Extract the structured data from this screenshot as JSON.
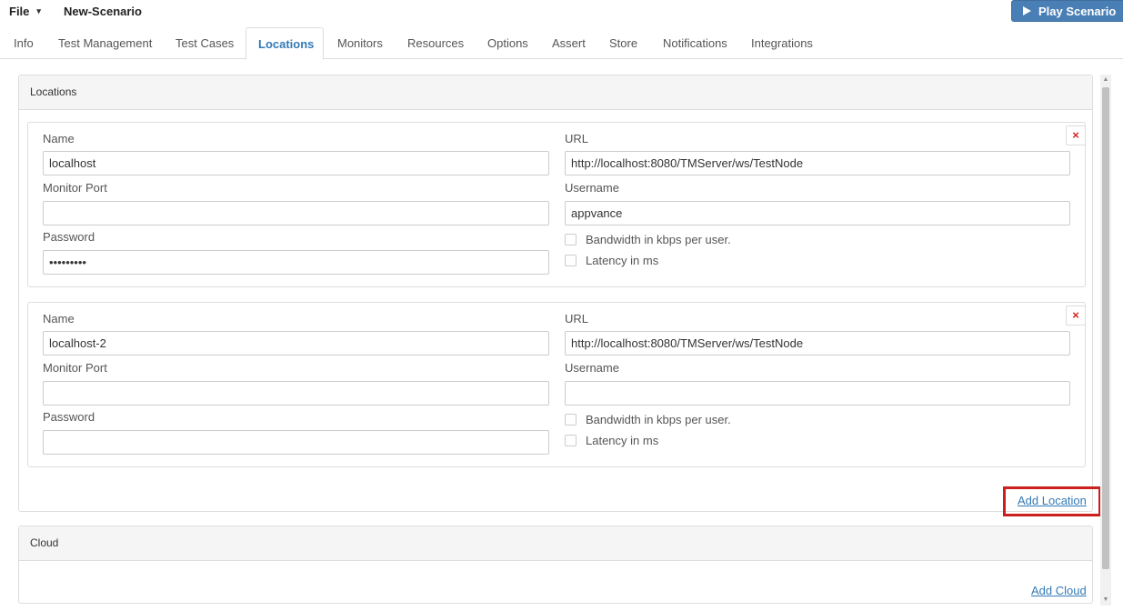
{
  "header": {
    "file_label": "File",
    "caret": "▾",
    "scenario_name": "New-Scenario",
    "play_label": "Play Scenario"
  },
  "tabs": [
    {
      "label": "Info"
    },
    {
      "label": "Test Management"
    },
    {
      "label": "Test Cases"
    },
    {
      "label": "Locations",
      "active": true
    },
    {
      "label": "Monitors"
    },
    {
      "label": "Resources"
    },
    {
      "label": "Options"
    },
    {
      "label": "Assert"
    },
    {
      "label": "Store"
    },
    {
      "label": "Notifications"
    },
    {
      "label": "Integrations"
    }
  ],
  "locations_panel": {
    "title": "Locations",
    "add_link": "Add Location"
  },
  "labels": {
    "name": "Name",
    "url": "URL",
    "monitor_port": "Monitor Port",
    "username": "Username",
    "password": "Password",
    "bandwidth": "Bandwidth in kbps per user.",
    "latency": "Latency in ms",
    "remove": "×"
  },
  "locations": [
    {
      "name": "localhost",
      "url": "http://localhost:8080/TMServer/ws/TestNode",
      "monitor_port": "",
      "username": "appvance",
      "password": "•••••••••"
    },
    {
      "name": "localhost-2",
      "url": "http://localhost:8080/TMServer/ws/TestNode",
      "monitor_port": "",
      "username": "",
      "password": ""
    }
  ],
  "cloud_panel": {
    "title": "Cloud",
    "add_link": "Add Cloud"
  },
  "colors": {
    "accent": "#337ab7",
    "play_button": "#4a7fb5",
    "remove": "#d9221c",
    "highlight": "#cc1f1f"
  }
}
